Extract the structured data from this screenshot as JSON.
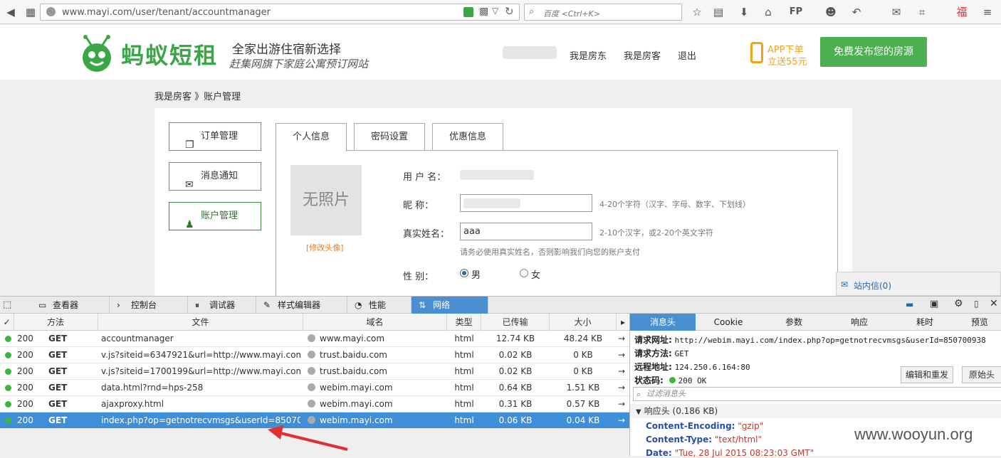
{
  "browser": {
    "url": "www.mayi.com/user/tenant/accountmanager",
    "search_placeholder": "百度 <Ctrl+K>",
    "fp_label": "FP"
  },
  "header": {
    "logo_text": "蚂蚁短租",
    "slogan": "全家出游住宿新选择",
    "slogan_sub": "赶集网旗下家庭公寓预订网站",
    "nav": [
      "我是房东",
      "我是房客",
      "退出"
    ],
    "app_line1": "APP下单",
    "app_line2": "立送55元",
    "publish_button": "免费发布您的房源"
  },
  "breadcrumb": "我是房客 》账户管理",
  "sidebar": {
    "items": [
      {
        "label": "订单管理",
        "icon": "document-icon"
      },
      {
        "label": "消息通知",
        "icon": "envelope-icon"
      },
      {
        "label": "账户管理",
        "icon": "user-icon"
      }
    ]
  },
  "tabs": [
    "个人信息",
    "密码设置",
    "优惠信息"
  ],
  "profile": {
    "avatar_placeholder": "无照片",
    "avatar_link": "[修改头像]",
    "username_label": "用 户 名：",
    "nickname_label": "昵    称：",
    "nickname_hint": "4-20个字符（汉字、字母、数字、下划线）",
    "realname_label": "真实姓名：",
    "realname_value": "aaa",
    "realname_hint": "2-10个汉字，或2-20个英文字符",
    "realname_note": "请务必使用真实姓名，否则影响我们向您的账户支付",
    "gender_label": "性    别：",
    "gender_options": [
      "男",
      "女"
    ]
  },
  "msg_widget": "站内信(0)",
  "devtools": {
    "tabs": [
      "查看器",
      "控制台",
      "调试器",
      "样式编辑器",
      "性能",
      "网络"
    ],
    "columns": [
      "✓",
      "方法",
      "文件",
      "域名",
      "类型",
      "已传输",
      "大小"
    ],
    "rows": [
      {
        "status": "200",
        "method": "GET",
        "file": "accountmanager",
        "domain": "www.mayi.com",
        "type": "html",
        "transferred": "12.74 KB",
        "size": "48.24 KB"
      },
      {
        "status": "200",
        "method": "GET",
        "file": "v.js?siteid=6347921&url=http://www.mayi.com...",
        "domain": "trust.baidu.com",
        "type": "html",
        "transferred": "0.02 KB",
        "size": "0 KB"
      },
      {
        "status": "200",
        "method": "GET",
        "file": "v.js?siteid=1700199&url=http://www.mayi.com...",
        "domain": "trust.baidu.com",
        "type": "html",
        "transferred": "0.02 KB",
        "size": "0 KB"
      },
      {
        "status": "200",
        "method": "GET",
        "file": "data.html?rnd=hps-258",
        "domain": "webim.mayi.com",
        "type": "html",
        "transferred": "0.64 KB",
        "size": "1.51 KB"
      },
      {
        "status": "200",
        "method": "GET",
        "file": "ajaxproxy.html",
        "domain": "webim.mayi.com",
        "type": "html",
        "transferred": "0.31 KB",
        "size": "0.57 KB"
      },
      {
        "status": "200",
        "method": "GET",
        "file": "index.php?op=getnotrecvmsgs&userId=85070...",
        "domain": "webim.mayi.com",
        "type": "html",
        "transferred": "0.06 KB",
        "size": "0.04 KB"
      }
    ],
    "detail": {
      "tabs": [
        "消息头",
        "Cookie",
        "参数",
        "响应",
        "耗时",
        "预览"
      ],
      "request_url_label": "请求网址:",
      "request_url": "http://webim.mayi.com/index.php?op=getnotrecvmsgs&userId=850700938",
      "method_label": "请求方法:",
      "method": "GET",
      "remote_label": "远程地址:",
      "remote": "124.250.6.164:80",
      "status_label": "状态码:",
      "status": "200 OK",
      "edit_button": "编辑和重发",
      "raw_button": "原始头",
      "filter_placeholder": "过滤消息头",
      "response_section": "响应头 (0.186 KB)",
      "headers": [
        {
          "k": "Content-Encoding:",
          "v": "\"gzip\""
        },
        {
          "k": "Content-Type:",
          "v": "\"text/html\""
        },
        {
          "k": "Date:",
          "v": "\"Tue, 28 Jul 2015 08:23:03 GMT\""
        }
      ]
    }
  },
  "watermark": "www.wooyun.org"
}
